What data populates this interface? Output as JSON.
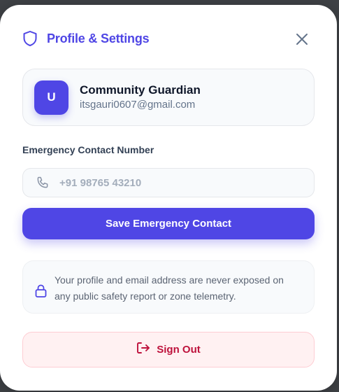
{
  "header": {
    "icon": "shield-icon",
    "title": "Profile & Settings",
    "close_icon": "close-icon",
    "accent_color": "#4f46e5"
  },
  "profile": {
    "avatar_initial": "U",
    "name": "Community Guardian",
    "email": "itsgauri0607@gmail.com"
  },
  "emergency_contact": {
    "label": "Emergency Contact Number",
    "icon": "phone-icon",
    "placeholder": "+91 98765 43210",
    "value": "",
    "save_label": "Save Emergency Contact"
  },
  "privacy": {
    "icon": "lock-icon",
    "text_line1": "Your profile and email address are never exposed on",
    "text_line2": "any public safety report or zone telemetry."
  },
  "sign_out": {
    "icon": "sign-out-icon",
    "label": "Sign Out",
    "color": "#be123c"
  }
}
